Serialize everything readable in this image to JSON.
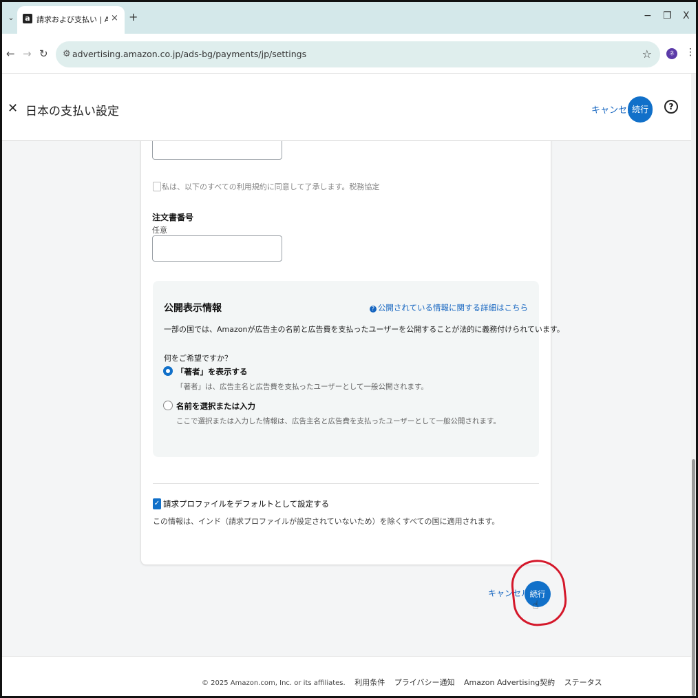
{
  "browser": {
    "tab_title": "請求および支払い | Amazon Ads",
    "tab_favicon": "a",
    "tab_close": "×",
    "new_tab": "+",
    "tab_menu": "⌄",
    "url": "advertising.amazon.co.jp/ads-bg/payments/jp/settings",
    "profile_initial": "ネ",
    "window_controls": [
      "−",
      "❐",
      "X"
    ]
  },
  "header": {
    "title": "日本の支払い設定",
    "close_icon": "x-icon",
    "cancel": "キャンセル",
    "continue": "続行",
    "help_glyph": "?"
  },
  "form": {
    "tos_label": "私は、以下のすべての利用規約に同意して了承します。税務協定",
    "po_label": "注文書番号",
    "po_hint": "任意",
    "po_value": ""
  },
  "disclosure": {
    "title": "公開表示情報",
    "info_link": "公開されている情報に関する詳細はこちら",
    "description": "一部の国では、Amazonが広告主の名前と広告費を支払ったユーザーを公開することが法的に義務付けられています。",
    "question": "何をご希望ですか？",
    "options": [
      {
        "label": "「著者」を表示する",
        "desc": "「著者」は、広告主名と広告費を支払ったユーザーとして一般公開されます。",
        "selected": true
      },
      {
        "label": "名前を選択または入力",
        "desc": "ここで選択または入力した情報は、広告主名と広告費を支払ったユーザーとして一般公開されます。",
        "selected": false
      }
    ]
  },
  "default_profile": {
    "label": "請求プロファイルをデフォルトとして設定する",
    "note": "この情報は、インド（請求プロファイルが設定されていないため）を除くすべての国に適用されます。",
    "checked": true
  },
  "actions": {
    "cancel": "キャンセル",
    "continue": "続行"
  },
  "footer": {
    "copyright": "© 2025 Amazon.com, Inc. or its affiliates.",
    "links": [
      "利用条件",
      "プライバシー通知",
      "Amazon Advertising契約",
      "ステータス"
    ]
  },
  "colors": {
    "accent": "#1170c9",
    "link": "#1565c0",
    "annotation": "#d4172a",
    "tab_strip": "#d4e8ea"
  }
}
